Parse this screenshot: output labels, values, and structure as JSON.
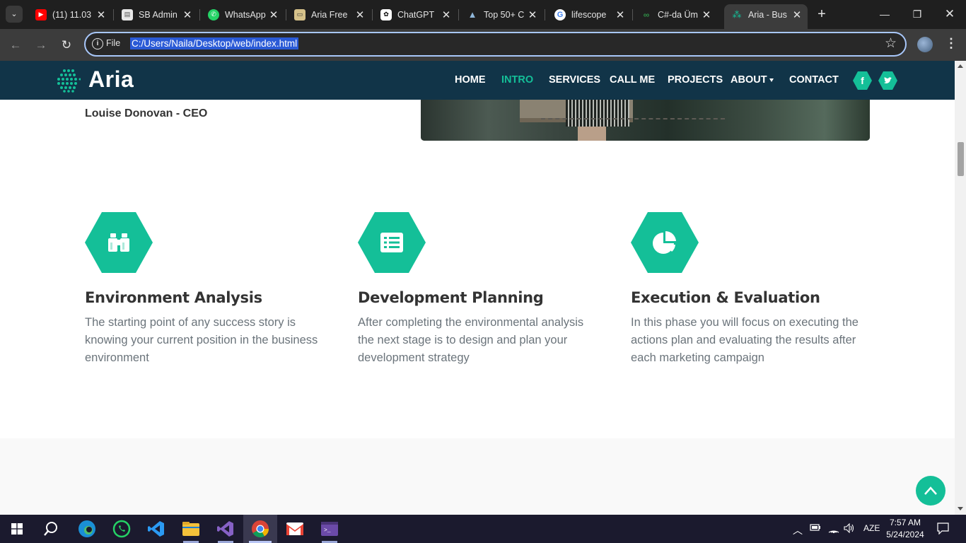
{
  "browser": {
    "tabs": [
      {
        "title": "(11) 11.03",
        "favicon": "youtube-icon",
        "color": "#ff0000"
      },
      {
        "title": "SB Admin",
        "favicon": "document-icon",
        "color": "#e8e8e8"
      },
      {
        "title": "WhatsApp",
        "favicon": "whatsapp-icon",
        "color": "#25d366"
      },
      {
        "title": "Aria Free",
        "favicon": "aria-icon",
        "color": "#d6c28a"
      },
      {
        "title": "ChatGPT",
        "favicon": "chatgpt-icon",
        "color": "#ffffff"
      },
      {
        "title": "Top 50+ C",
        "favicon": "mountain-icon",
        "color": "#8fb7d9"
      },
      {
        "title": "lifescope",
        "favicon": "google-icon",
        "color": "#4285f4"
      },
      {
        "title": "C#-da Üm",
        "favicon": "geeks-icon",
        "color": "#2f8d46"
      },
      {
        "title": "Aria - Bus",
        "favicon": "aria-icon",
        "color": "#14bf98",
        "active": true
      }
    ],
    "address": {
      "scheme_label": "File",
      "url": "C:/Users/Naila/Desktop/web/index.html"
    }
  },
  "site": {
    "logo": "Aria",
    "menu": [
      {
        "label": "HOME",
        "active": false
      },
      {
        "label": "INTRO",
        "active": true
      },
      {
        "label": "SERVICES",
        "active": false
      },
      {
        "label": "CALL ME",
        "active": false
      },
      {
        "label": "PROJECTS",
        "active": false
      },
      {
        "label": "ABOUT",
        "active": false,
        "dropdown": true
      },
      {
        "label": "CONTACT",
        "active": false
      }
    ],
    "social": [
      "facebook-icon",
      "twitter-icon"
    ],
    "testimonial_author": "Louise Donovan - CEO",
    "features": [
      {
        "icon": "binoculars-icon",
        "title": "Environment Analysis",
        "text": "The starting point of any success story is knowing your current position in the business environment"
      },
      {
        "icon": "list-icon",
        "title": "Development Planning",
        "text": "After completing the environmental analysis the next stage is to design and plan your development strategy"
      },
      {
        "icon": "pie-chart-icon",
        "title": "Execution & Evaluation",
        "text": "In this phase you will focus on executing the actions plan and evaluating the results after each marketing campaign"
      }
    ],
    "accent": "#14bf98",
    "nav_bg": "#113448"
  },
  "taskbar": {
    "language": "AZE",
    "time": "7:57 AM",
    "date": "5/24/2024"
  }
}
